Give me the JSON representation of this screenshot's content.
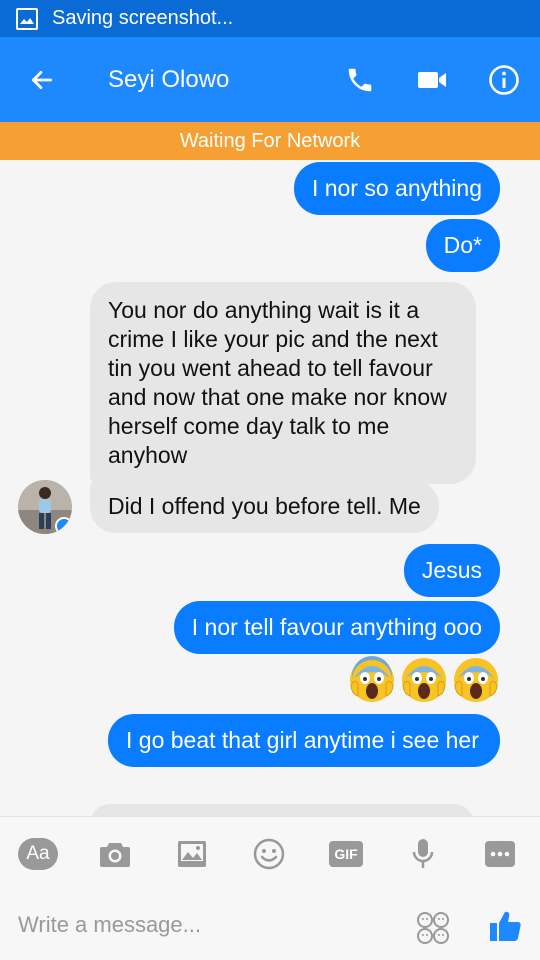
{
  "status_bar": {
    "text": "Saving screenshot..."
  },
  "header": {
    "contact_name": "Seyi Olowo"
  },
  "network_banner": {
    "text": "Waiting For Network"
  },
  "messages": [
    {
      "from": "me",
      "text": "I nor so anything"
    },
    {
      "from": "me",
      "text": "Do*"
    },
    {
      "from": "them",
      "text": "You nor do anything wait is it a crime I like your pic and the next tin you went ahead to tell favour and now that one make nor know herself come day talk to me anyhow"
    },
    {
      "from": "them",
      "text": "Did I offend you before tell. Me"
    },
    {
      "from": "me",
      "text": "Jesus"
    },
    {
      "from": "me",
      "text": "I nor tell favour anything  ooo"
    },
    {
      "from": "me",
      "text": "😱😱😱"
    },
    {
      "from": "me",
      "text": "I go beat that girl anytime i see her"
    }
  ],
  "composer": {
    "aa_label": "Aa",
    "gif_label": "GIF",
    "placeholder": "Write a message..."
  },
  "colors": {
    "accent": "#1e88ff",
    "status_bar": "#0a6bd6",
    "outgoing_bubble": "#0a7cff",
    "incoming_bubble": "#e6e6e6",
    "network_banner": "#f6a033"
  }
}
